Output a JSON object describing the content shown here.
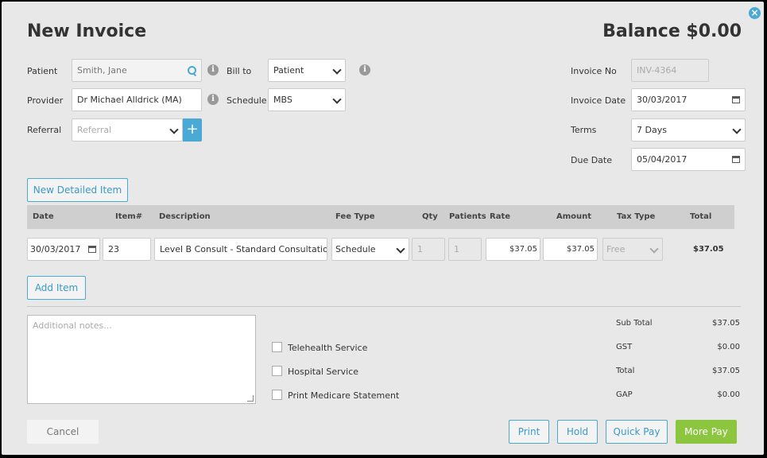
{
  "header": {
    "title": "New Invoice",
    "balance": "Balance $0.00"
  },
  "patient": {
    "label": "Patient",
    "value": "Smith, Jane"
  },
  "provider": {
    "label": "Provider",
    "value": "Dr Michael Alldrick (MA)"
  },
  "referral": {
    "label": "Referral",
    "placeholder": "Referral"
  },
  "bill_to": {
    "label": "Bill to",
    "value": "Patient"
  },
  "schedule": {
    "label": "Schedule",
    "value": "MBS"
  },
  "invoice_no": {
    "label": "Invoice No",
    "value": "INV-4364"
  },
  "invoice_date": {
    "label": "Invoice Date",
    "value": "30/03/2017"
  },
  "terms": {
    "label": "Terms",
    "value": "7 Days"
  },
  "due_date": {
    "label": "Due Date",
    "value": "05/04/2017"
  },
  "buttons": {
    "new_detailed_item": "New Detailed Item",
    "add_item": "Add Item",
    "cancel": "Cancel",
    "print": "Print",
    "hold": "Hold",
    "quick_pay": "Quick Pay",
    "more_pay": "More Pay"
  },
  "table": {
    "headers": [
      "Date",
      "Item#",
      "Description",
      "Fee Type",
      "Qty",
      "Patients",
      "Rate",
      "Amount",
      "Tax Type",
      "Total"
    ],
    "row": {
      "date": "30/03/2017",
      "item": "23",
      "description": "Level B Consult - Standard Consultation I",
      "fee_type": "Schedule",
      "qty": "1",
      "patients": "1",
      "rate": "$37.05",
      "amount": "$37.05",
      "tax_type": "Free",
      "total": "$37.05"
    }
  },
  "notes": {
    "placeholder": "Additional notes..."
  },
  "checkboxes": [
    "Telehealth Service",
    "Hospital Service",
    "Print Medicare Statement"
  ],
  "totals": {
    "sub_total_label": "Sub Total",
    "sub_total": "$37.05",
    "gst_label": "GST",
    "gst": "$0.00",
    "total_label": "Total",
    "total": "$37.05",
    "gap_label": "GAP",
    "gap": "$0.00"
  },
  "icons": {
    "close": "close-icon",
    "search": "search-icon",
    "info": "info-icon",
    "calendar": "calendar-icon",
    "plus": "plus-icon"
  },
  "colors": {
    "accent": "#4aa9d5",
    "more_pay": "#8cc63f"
  }
}
